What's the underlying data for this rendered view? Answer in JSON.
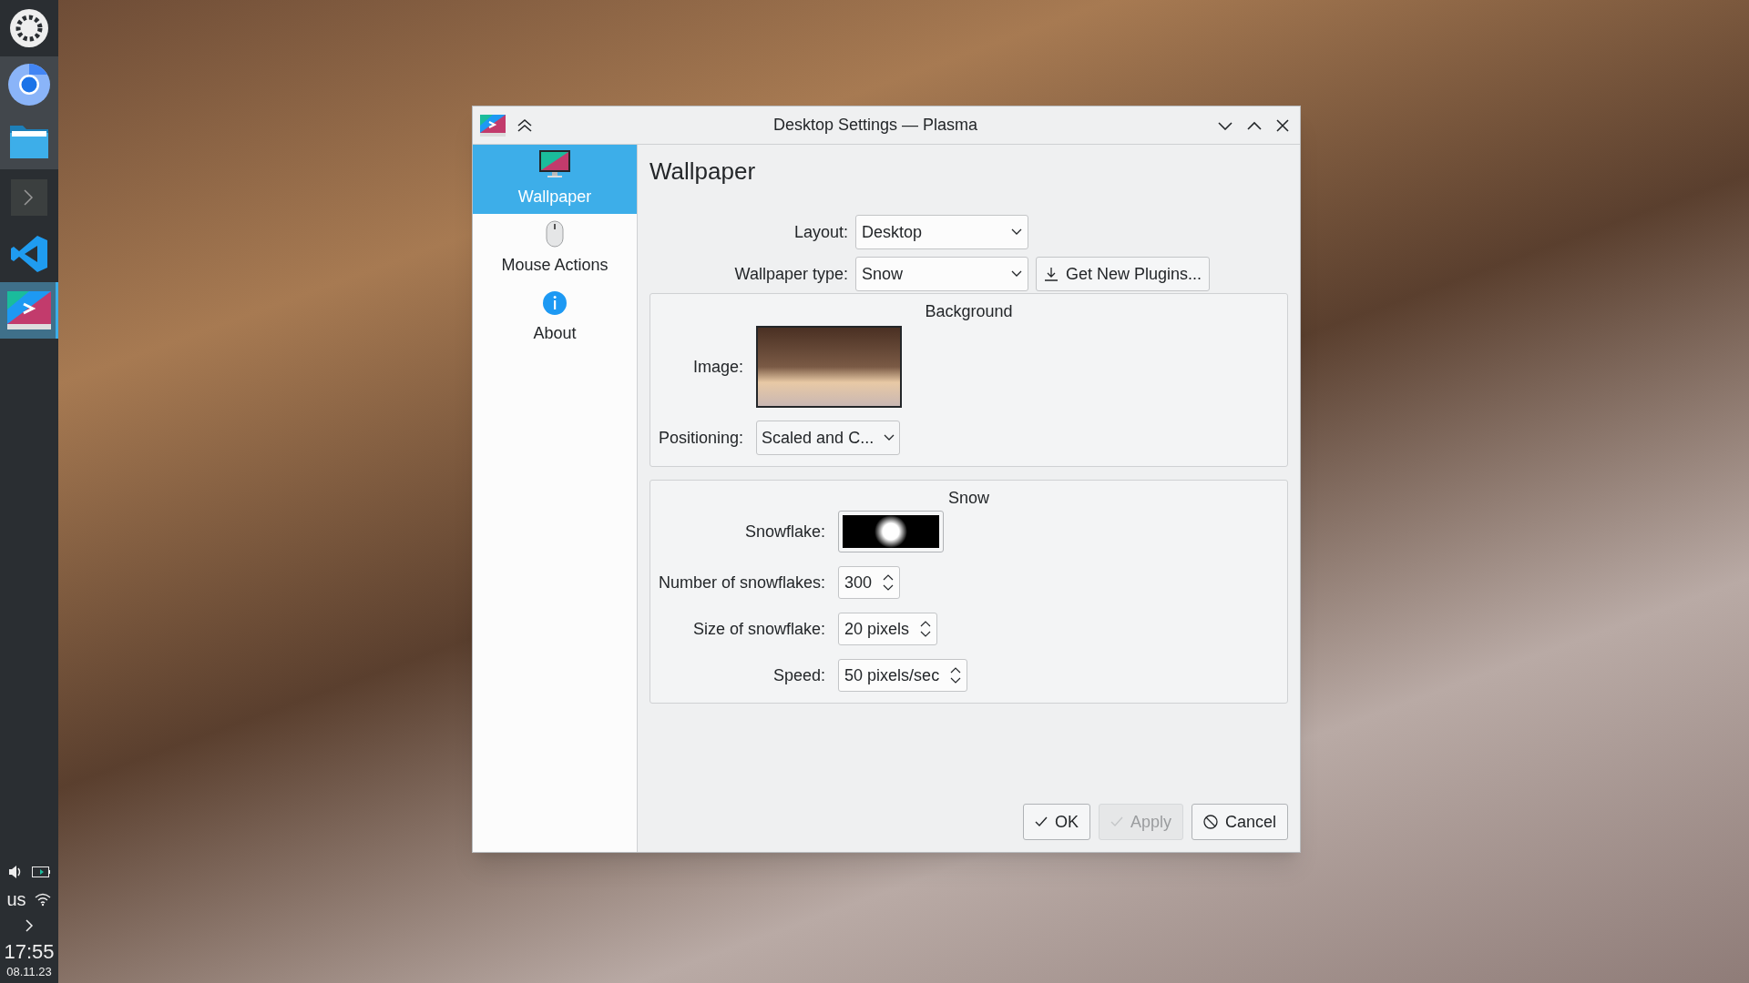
{
  "taskbar": {
    "launchers": [
      {
        "kind": "settings",
        "running": false,
        "selected": false
      },
      {
        "kind": "browser",
        "running": true,
        "selected": false
      },
      {
        "kind": "files",
        "running": true,
        "selected": false
      },
      {
        "kind": "terminal",
        "running": false,
        "selected": false
      },
      {
        "kind": "editor",
        "running": false,
        "selected": false
      },
      {
        "kind": "desktop-settings",
        "running": true,
        "selected": true
      }
    ],
    "keyboard_layout": "us",
    "time": "17:55",
    "date": "08.11.23"
  },
  "window": {
    "title": "Desktop Settings — Plasma"
  },
  "sidebar": {
    "items": [
      {
        "kind": "wallpaper",
        "label": "Wallpaper",
        "selected": true
      },
      {
        "kind": "mouse",
        "label": "Mouse Actions",
        "selected": false
      },
      {
        "kind": "about",
        "label": "About",
        "selected": false
      }
    ]
  },
  "page": {
    "heading": "Wallpaper",
    "layout": {
      "label": "Layout:",
      "value": "Desktop"
    },
    "wallpaper_type": {
      "label": "Wallpaper type:",
      "value": "Snow"
    },
    "get_new_plugins": "Get New Plugins...",
    "background_group": {
      "title": "Background",
      "image_label": "Image:",
      "positioning_label": "Positioning:",
      "positioning_value": "Scaled and C..."
    },
    "snow_group": {
      "title": "Snow",
      "snowflake_label": "Snowflake:",
      "spinboxes": [
        {
          "label": "Number of snowflakes:",
          "value": "300"
        },
        {
          "label": "Size of snowflake:",
          "value": "20 pixels"
        },
        {
          "label": "Speed:",
          "value": "50 pixels/sec"
        }
      ]
    }
  },
  "buttons": [
    {
      "kind": "ok",
      "label": "OK",
      "disabled": false
    },
    {
      "kind": "apply",
      "label": "Apply",
      "disabled": true
    },
    {
      "kind": "cancel",
      "label": "Cancel",
      "disabled": false
    }
  ]
}
